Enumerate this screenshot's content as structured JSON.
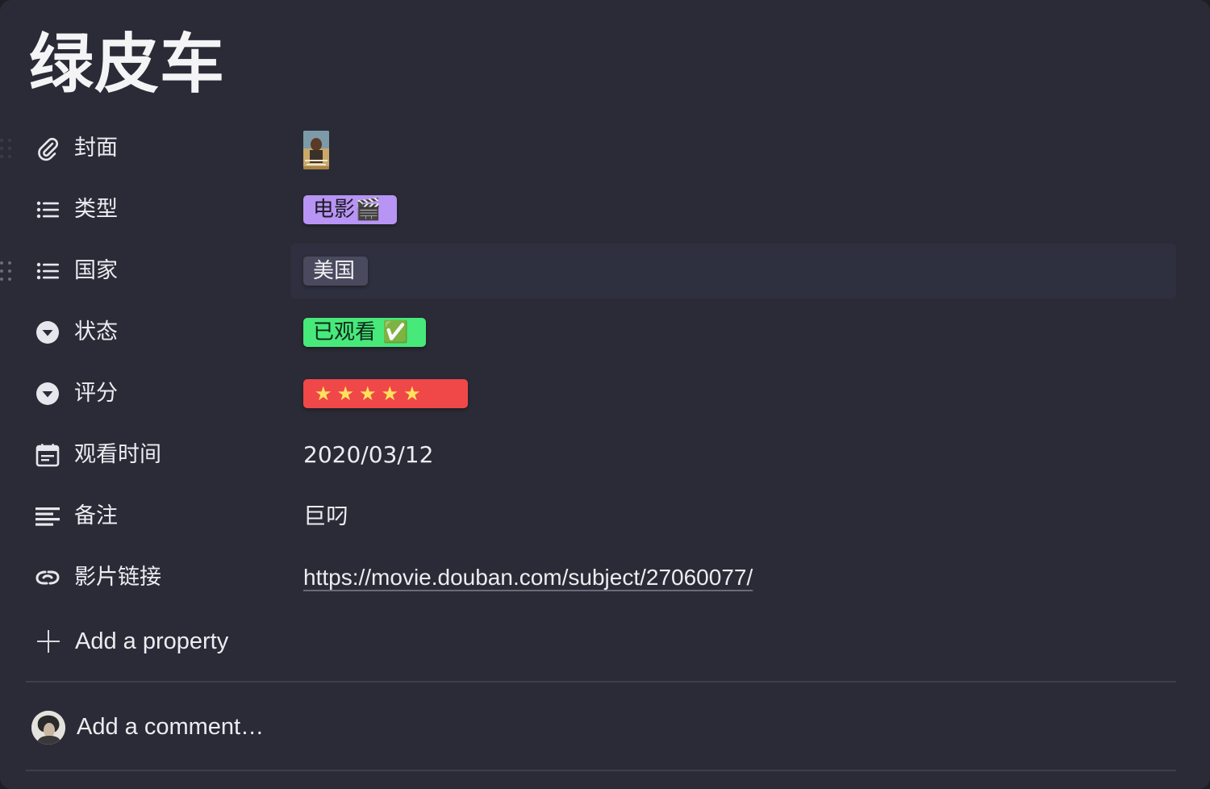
{
  "page": {
    "title": "绿皮车"
  },
  "properties": [
    {
      "label": "封面",
      "icon": "paperclip-icon",
      "type": "files"
    },
    {
      "label": "类型",
      "icon": "list-icon",
      "type": "multi-select",
      "value": "电影🎬",
      "color": "#b894f4"
    },
    {
      "label": "国家",
      "icon": "list-icon",
      "type": "multi-select",
      "value": "美国",
      "color": "#4a4a5e"
    },
    {
      "label": "状态",
      "icon": "select-icon",
      "type": "select",
      "value": "已观看 ✅",
      "color": "#47e97a"
    },
    {
      "label": "评分",
      "icon": "select-icon",
      "type": "select",
      "value": "★★★★★",
      "color": "#f04848",
      "rating": 5
    },
    {
      "label": "观看时间",
      "icon": "calendar-icon",
      "type": "date",
      "value": "2020/03/12"
    },
    {
      "label": "备注",
      "icon": "text-icon",
      "type": "text",
      "value": "巨叼"
    },
    {
      "label": "影片链接",
      "icon": "link-icon",
      "type": "url",
      "value": "https://movie.douban.com/subject/27060077/"
    }
  ],
  "add_property": {
    "label": "Add a property"
  },
  "comment": {
    "placeholder": "Add a comment…"
  }
}
